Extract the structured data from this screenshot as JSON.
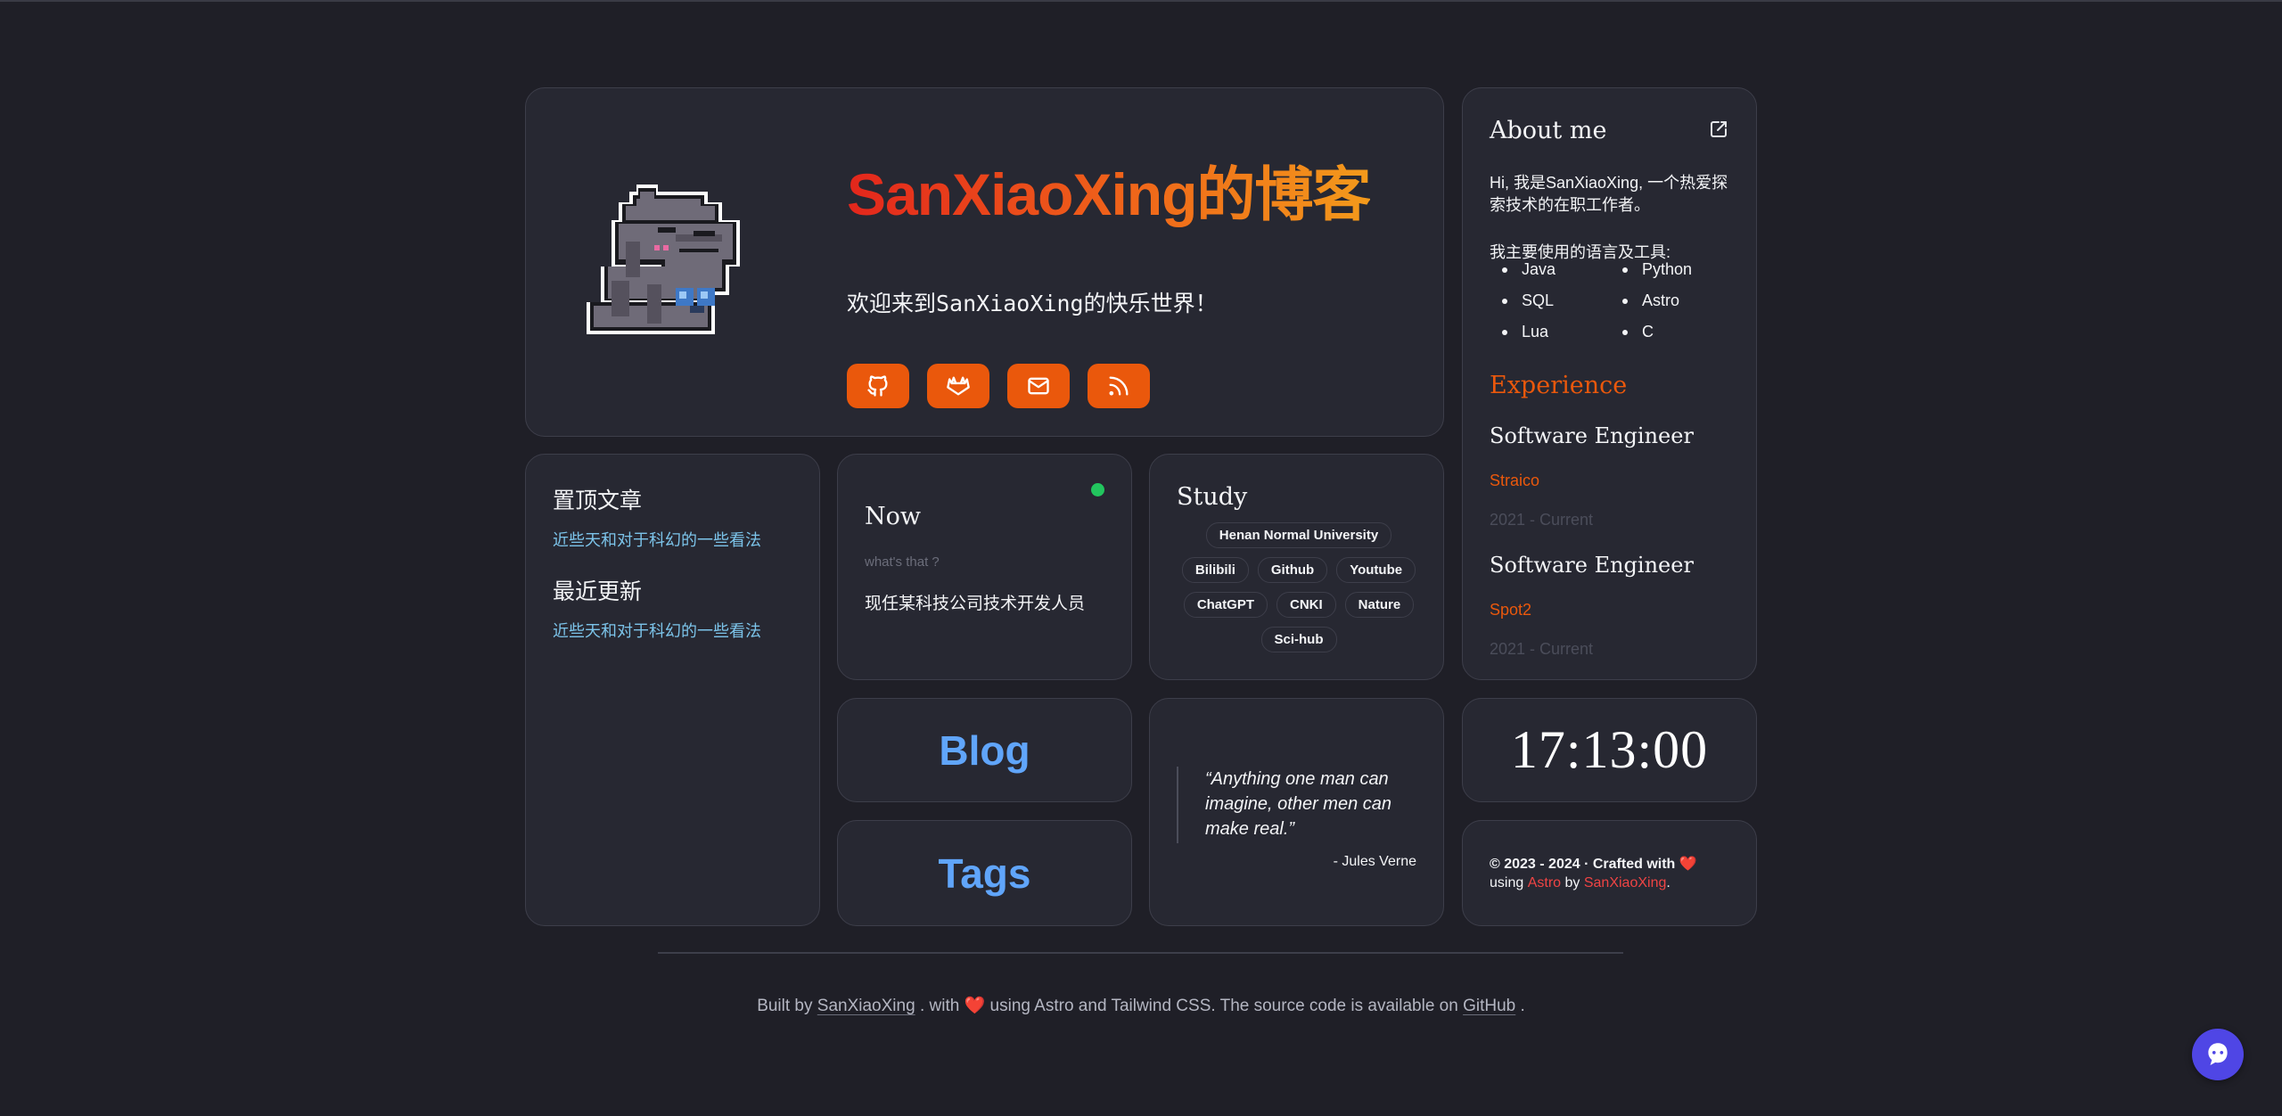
{
  "hero": {
    "title": "SanXiaoXing的博客",
    "subtitle": "欢迎来到SanXiaoXing的快乐世界！",
    "social": [
      {
        "icon": "github-icon"
      },
      {
        "icon": "gitlab-icon"
      },
      {
        "icon": "mail-icon"
      },
      {
        "icon": "rss-icon"
      }
    ],
    "accent_color": "#ea580c"
  },
  "about": {
    "title": "About me",
    "intro": "Hi, 我是SanXiaoXing, 一个热爱探索技术的在职工作者。",
    "tools_label": "我主要使用的语言及工具:",
    "languages": [
      "Java",
      "Python",
      "SQL",
      "Astro",
      "Lua",
      "C"
    ],
    "experience_heading": "Experience",
    "jobs": [
      {
        "title": "Software Engineer",
        "company": "Straico",
        "period": "2021 - Current"
      },
      {
        "title": "Software Engineer",
        "company": "Spot2",
        "period": "2021 - Current"
      }
    ]
  },
  "pinned": {
    "pinned_heading": "置顶文章",
    "pinned_link": "近些天和对于科幻的一些看法",
    "recent_heading": "最近更新",
    "recent_link": "近些天和对于科幻的一些看法"
  },
  "now": {
    "title": "Now",
    "question": "what's that ?",
    "text": "现任某科技公司技术开发人员",
    "status_color": "#22c55e"
  },
  "study": {
    "title": "Study",
    "tags": [
      "Henan Normal University",
      "Bilibili",
      "Github",
      "Youtube",
      "ChatGPT",
      "CNKI",
      "Nature",
      "Sci-hub"
    ]
  },
  "nav": {
    "blog": "Blog",
    "tags": "Tags"
  },
  "quote": {
    "text": "“Anything one man can imagine, other men can make real.”",
    "author": "- Jules Verne"
  },
  "clock": {
    "time": "17:13:00"
  },
  "copyright": {
    "prefix": "© 2023 - 2024 · Crafted with",
    "heart": "❤️",
    "using": "using",
    "astro": "Astro",
    "by": "by",
    "author": "SanXiaoXing",
    "end": "."
  },
  "footer": {
    "built_by": "Built by",
    "author": "SanXiaoXing",
    "with": ". with",
    "heart": "❤️",
    "middle": "using Astro and Tailwind CSS. The source code is available on",
    "github": "GitHub",
    "end": "."
  }
}
